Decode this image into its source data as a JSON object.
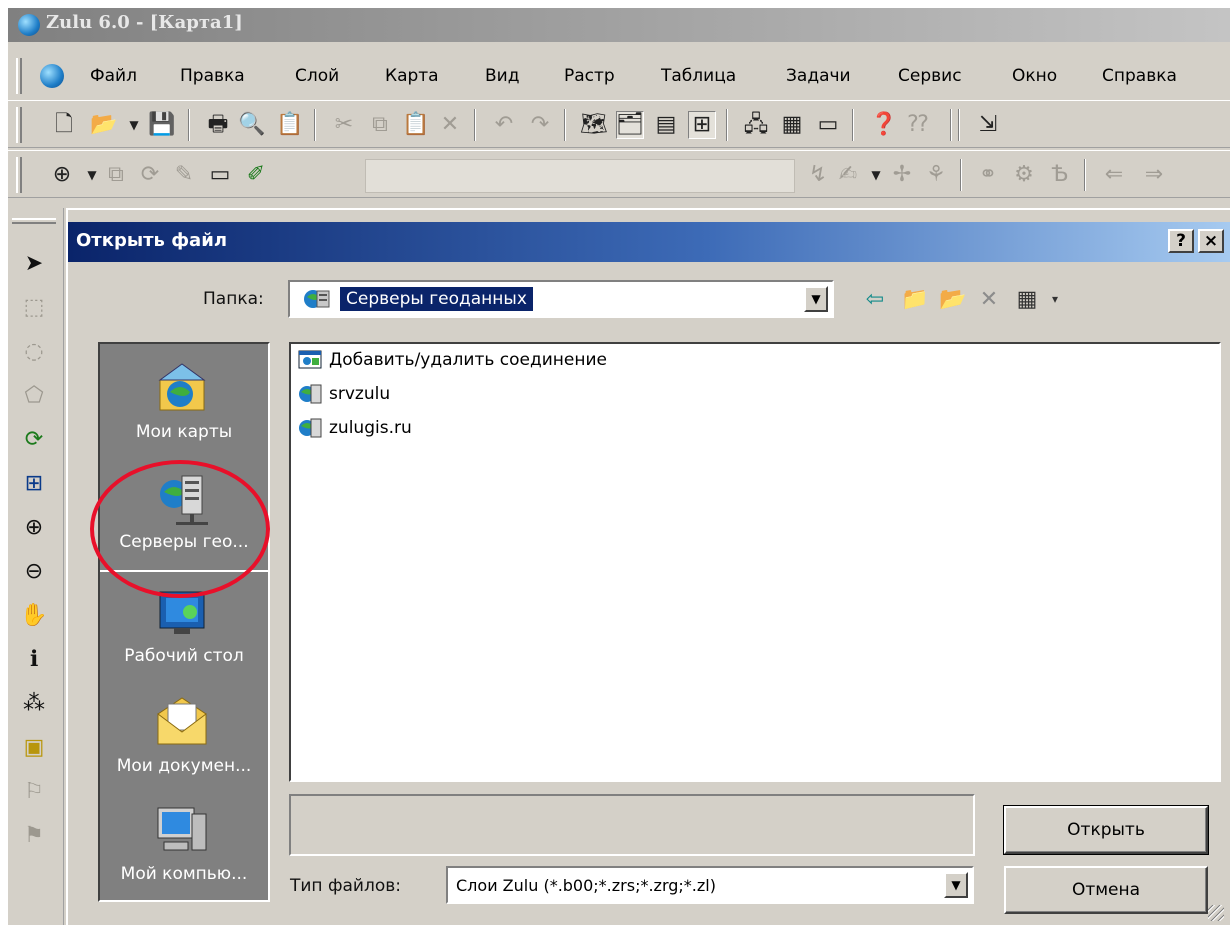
{
  "window": {
    "title": "Zulu 6.0 - [Карта1]"
  },
  "menu": {
    "items": [
      "Файл",
      "Правка",
      "Слой",
      "Карта",
      "Вид",
      "Растр",
      "Таблица",
      "Задачи",
      "Сервис",
      "Окно",
      "Справка"
    ]
  },
  "toolbar1": {
    "icons": [
      "new-document-icon",
      "open-folder-icon",
      "save-icon",
      "print-icon",
      "print-preview-icon",
      "properties-icon",
      "cut-icon",
      "copy-icon",
      "paste-icon",
      "delete-icon",
      "undo-icon",
      "redo-icon",
      "layers-icon",
      "layer-folder-icon",
      "table-icon",
      "zoom-frame-icon",
      "map-layers-icon",
      "chart-icon",
      "window-icon",
      "help-icon",
      "context-help-icon"
    ]
  },
  "toolbar2": {
    "icons": [
      "add-object-icon",
      "copy-object-icon",
      "rotate-object-icon",
      "edit-object-icon",
      "label-icon",
      "lock-edit-icon",
      "snap-icon",
      "draw-icon",
      "node-icon",
      "node-edit-icon",
      "link-icon",
      "network-icon",
      "text-icon",
      "back-arrow-icon",
      "forward-arrow-icon"
    ]
  },
  "left_tools": {
    "icons": [
      "select-arrow-icon",
      "select-box-icon",
      "select-circle-icon",
      "select-polygon-icon",
      "refresh-icon",
      "fit-view-icon",
      "zoom-in-icon",
      "zoom-out-icon",
      "pan-hand-icon",
      "info-icon",
      "scatter-icon",
      "scale-icon",
      "route-icon",
      "route-edit-icon"
    ]
  },
  "dialog": {
    "title": "Открыть файл",
    "help_button": "?",
    "close_button": "×",
    "folder_label": "Папка:",
    "folder_value": "Серверы геоданных",
    "places": [
      {
        "label": "Мои карты",
        "icon": "my-maps-icon"
      },
      {
        "label": "Серверы гео...",
        "icon": "geo-servers-icon"
      },
      {
        "label": "Рабочий стол",
        "icon": "desktop-icon"
      },
      {
        "label": "Мои докумен...",
        "icon": "my-documents-icon"
      },
      {
        "label": "Мой компью...",
        "icon": "my-computer-icon"
      }
    ],
    "files": [
      {
        "name": "Добавить/удалить соединение",
        "icon": "add-connection-icon"
      },
      {
        "name": "srvzulu",
        "icon": "server-icon"
      },
      {
        "name": "zulugis.ru",
        "icon": "server-icon"
      }
    ],
    "file_name_value": "",
    "file_type_label": "Тип файлов:",
    "file_type_value": "Слои Zulu (*.b00;*.zrs;*.zrg;*.zl)",
    "open_button": "Открыть",
    "cancel_button": "Отмена"
  },
  "colors": {
    "dialog_title_start": "#0a246a",
    "dialog_title_end": "#a6caf0",
    "highlight_circle": "#e8102a",
    "places_background": "#808080"
  }
}
